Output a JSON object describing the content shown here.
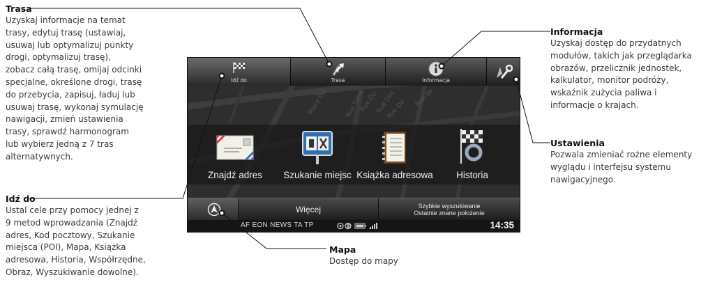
{
  "callouts": {
    "trasa": {
      "title": "Trasa",
      "lines": [
        "Uzyskaj informacje na temat",
        "trasy, edytuj trasę (ustawiaj,",
        "usuwaj lub optymalizuj punkty",
        "drogi, optymalizuj trasę),",
        "zobacz całą trasę, omijaj odcinki",
        "specjalne, określone drogi, trasę",
        "do przebycia, zapisuj, ładuj lub",
        "usuwaj trasę, wykonaj symulację",
        "nawigacji, zmień ustawienia",
        "trasy, sprawdź harmonogram",
        "lub wybierz jedną z 7 tras",
        "alternatywnych."
      ]
    },
    "idzdo": {
      "title": "Idź do",
      "lines": [
        "Ustal cele przy pomocy jednej z",
        "9 metod wprowadzania (Znajdź",
        "adres, Kod pocztowy, Szukanie",
        "miejsca (POI), Mapa, Książka",
        "adresowa, Historia, Współrzędne,",
        "Obraz, Wyszukiwanie dowolne)."
      ]
    },
    "informacja": {
      "title": "Informacja",
      "lines": [
        "Uzyskaj dostęp do przydatnych",
        "modułów, takich jak przeglądarka",
        "obrazów, przelicznik jednostek,",
        "kalkulator, monitor podróży,",
        "wskaźnik zużycia paliwa i",
        "informacje o krajach."
      ]
    },
    "ustawienia": {
      "title": "Ustawienia",
      "lines": [
        "Pozwala zmieniać rożne elementy",
        "wyglądu i interfejsu systemu",
        "nawigacyjnego."
      ]
    },
    "mapa": {
      "title": "Mapa",
      "lines": [
        "Dostęp do mapy"
      ]
    }
  },
  "screen": {
    "tabs": {
      "idz_do": "Idź do",
      "trasa": "Trasa",
      "informacja": "Informacja"
    },
    "menu": {
      "znajdz_adres": "Znajdź adres",
      "szukanie_miejsc": "Szukanie miejsc",
      "ksiazka_adresowa": "Książka adresowa",
      "historia": "Historia"
    },
    "bottom": {
      "wiecej": "Więcej",
      "szybkie_line1": "Szybkie wyszukiwanie",
      "szybkie_line2": "Ostatnie znane położenie"
    },
    "status": {
      "text": "AF EON NEWS TA TP",
      "clock": "14:35"
    },
    "map_streets": [
      "Place Du",
      "Rue Du",
      "Rue Des",
      "Rue Du",
      "Rue Saint",
      "Rue de"
    ]
  },
  "icons": {
    "idz_do": "checkered-flag-icon",
    "trasa": "route-arrow-icon",
    "informacja": "info-icon",
    "ustawienia": "wrench-settings-icon",
    "znajdz_adres": "envelope-icon",
    "szukanie_miejsc": "poi-sign-icon",
    "ksiazka_adresowa": "address-book-icon",
    "historia": "history-flag-icon",
    "mapa": "compass-arrow-icon"
  },
  "colors": {
    "screen_bg": "#2b2b2b",
    "leader_line": "#111111"
  }
}
